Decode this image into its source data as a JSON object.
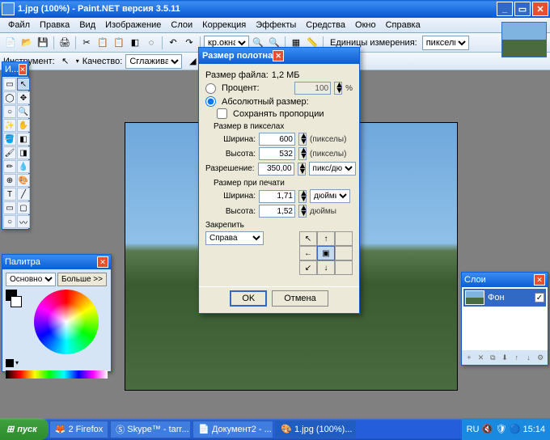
{
  "titlebar": {
    "title": "1.jpg (100%) - Paint.NET версия 3.5.11"
  },
  "menu": {
    "file": "Файл",
    "edit": "Правка",
    "view": "Вид",
    "image": "Изображение",
    "layers": "Слои",
    "adjustments": "Коррекция",
    "effects": "Эффекты",
    "tools": "Средства",
    "window": "Окно",
    "help": "Справка"
  },
  "toolbar": {
    "units_label": "Единицы измерения:",
    "units_value": "пикселы",
    "fit_window": "кр.окна"
  },
  "options": {
    "tool_label": "Инструмент:",
    "quality_label": "Качество:",
    "quality_value": "Сглажива..."
  },
  "tools_panel": {
    "title": "И..."
  },
  "dialog": {
    "title": "Размер полотна",
    "filesize_label": "Размер файла:",
    "filesize_value": "1,2 МБ",
    "percent_label": "Процент:",
    "percent_value": "100",
    "percent_unit": "%",
    "absolute_label": "Абсолютный размер:",
    "keep_ratio": "Сохранять пропорции",
    "pixel_size": "Размер в пикселах",
    "width_label": "Ширина:",
    "width_value": "600",
    "width_unit": "(пикселы)",
    "height_label": "Высота:",
    "height_value": "532",
    "height_unit": "(пикселы)",
    "resolution_label": "Разрешение:",
    "resolution_value": "350,00",
    "resolution_unit": "пикс/дюйм",
    "print_size": "Размер при печати",
    "pwidth_value": "1,71",
    "pheight_value": "1,52",
    "print_unit": "дюймы",
    "anchor_label": "Закрепить",
    "anchor_value": "Справа",
    "ok": "OK",
    "cancel": "Отмена"
  },
  "colors": {
    "title": "Палитра",
    "primary": "Основной",
    "more": "Больше >>"
  },
  "layers": {
    "title": "Слои",
    "bg": "Фон"
  },
  "taskbar": {
    "start": "пуск",
    "items": [
      "2 Firefox",
      "Skype™ - tarr...",
      "Документ2 - ...",
      "1.jpg (100%)..."
    ],
    "time": "15:14",
    "lang": "RU"
  }
}
